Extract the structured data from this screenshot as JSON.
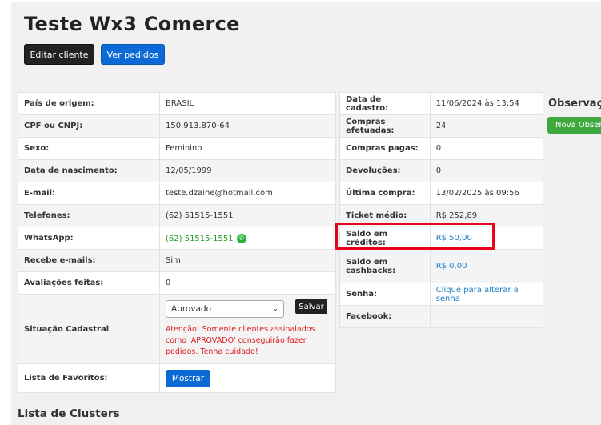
{
  "header": {
    "title": "Teste Wx3 Comerce",
    "edit_button": "Editar cliente",
    "orders_button": "Ver pedidos"
  },
  "left_table": {
    "rows": [
      {
        "label": "País de origem:",
        "value": "BRASIL"
      },
      {
        "label": "CPF ou CNPJ:",
        "value": "150.913.870-64"
      },
      {
        "label": "Sexo:",
        "value": "Feminino"
      },
      {
        "label": "Data de nascimento:",
        "value": "12/05/1999"
      },
      {
        "label": "E-mail:",
        "value": "teste.dzaine@hotmail.com"
      },
      {
        "label": "Telefones:",
        "value": "(62) 51515-1551"
      },
      {
        "label": "WhatsApp:",
        "value": "(62) 51515-1551"
      },
      {
        "label": "Recebe e-mails:",
        "value": "Sim"
      },
      {
        "label": "Avaliações feitas:",
        "value": "0"
      }
    ],
    "status": {
      "label": "Situação Cadastral",
      "selected": "Aprovado",
      "save_button": "Salvar",
      "warning": "Atenção! Somente clientes assinalados como 'APROVADO' conseguirão fazer pedidos. Tenha cuidado!"
    },
    "favorites": {
      "label": "Lista de Favoritos:",
      "button": "Mostrar"
    }
  },
  "right_table": {
    "rows": [
      {
        "label": "Data de cadastro:",
        "value": "11/06/2024 às 13:54"
      },
      {
        "label": "Compras efetuadas:",
        "value": "24"
      },
      {
        "label": "Compras pagas:",
        "value": "0"
      },
      {
        "label": "Devoluções:",
        "value": "0"
      },
      {
        "label": "Última compra:",
        "value": "13/02/2025 às 09:56"
      },
      {
        "label": "Ticket médio:",
        "value": "R$ 252,89"
      },
      {
        "label": "Saldo em créditos:",
        "value": "R$ 50,00"
      },
      {
        "label": "Saldo em cashbacks:",
        "value": "R$ 0,00"
      },
      {
        "label": "Senha:",
        "value": "Clique para alterar a senha"
      },
      {
        "label": "Facebook:",
        "value": ""
      }
    ]
  },
  "observations": {
    "title": "Observações",
    "new_button": "Nova Observação"
  },
  "clusters": {
    "title": "Lista de Clusters"
  },
  "icons": {
    "whatsapp": "whatsapp-icon",
    "select_arrow": "chevron-down-icon"
  },
  "colors": {
    "primary_blue": "#0c6ad6",
    "dark_button": "#222222",
    "link": "#1a7fc4",
    "whatsapp_green": "#1c9e2a",
    "warning_red": "#e01b1b",
    "highlight_red": "#e8001c",
    "observation_green": "#3fa83f"
  }
}
